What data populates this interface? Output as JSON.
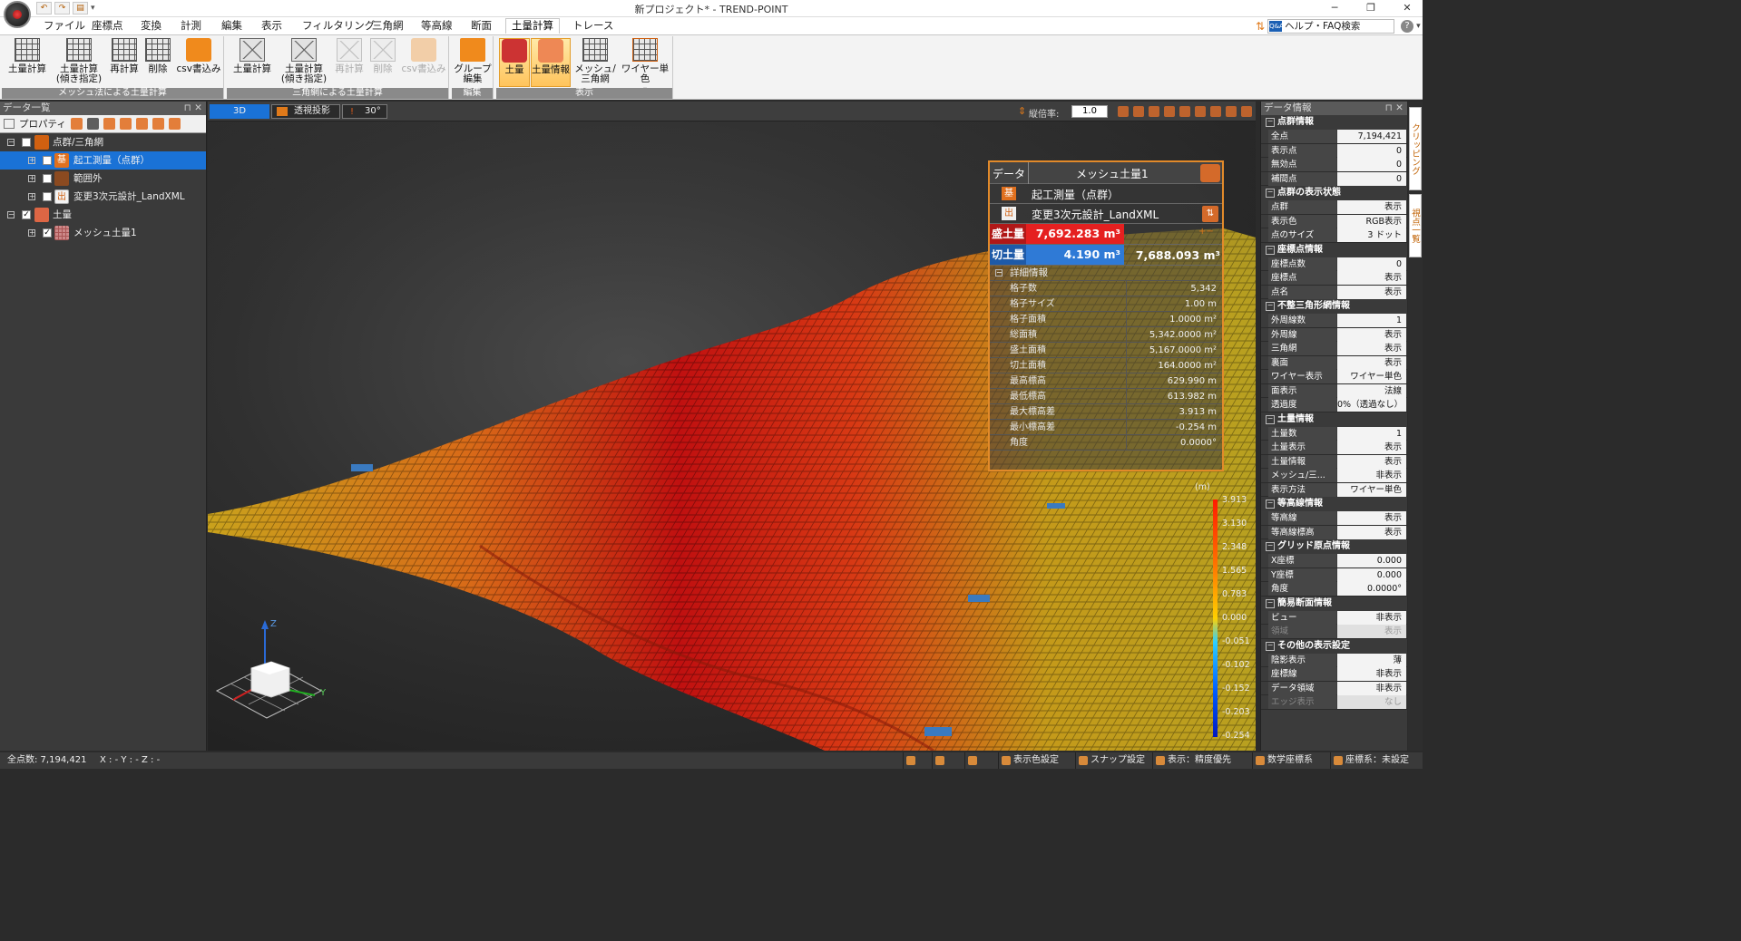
{
  "window": {
    "title": "新プロジェクト* - TREND-POINT"
  },
  "menus": [
    "ファイル",
    "座標点",
    "変換",
    "計測",
    "編集",
    "表示",
    "フィルタリング",
    "三角網",
    "等高線",
    "断面",
    "土量計算",
    "トレース"
  ],
  "help": {
    "label": "ヘルプ・FAQ検索",
    "placeholder": "ヘルプ・FAQ検索"
  },
  "ribbon": {
    "groups": [
      "メッシュ法による土量計算",
      "三角網による土量計算",
      "編集",
      "表示"
    ],
    "mesh": [
      "土量計算",
      "土量計算\n(傾き指定)",
      "再計算",
      "削除",
      "csv書込み"
    ],
    "tri": [
      "土量計算",
      "土量計算\n(傾き指定)",
      "再計算",
      "削除",
      "csv書込み"
    ],
    "edit": [
      "グループ\n編集"
    ],
    "display": [
      "土量",
      "土量情報",
      "メッシュ/\n三角網",
      "ワイヤー単色"
    ]
  },
  "left_panel": {
    "title": "データ一覧",
    "tool_label": "プロパティ",
    "tree": [
      {
        "label": "点群/三角網",
        "icon": ""
      },
      {
        "label": "起工測量（点群）",
        "icon": "基"
      },
      {
        "label": "範囲外",
        "icon": ""
      },
      {
        "label": "変更3次元設計_LandXML",
        "icon": "出"
      },
      {
        "label": "土量",
        "icon": ""
      },
      {
        "label": "メッシュ土量1",
        "icon": ""
      }
    ]
  },
  "viewport": {
    "mode_3d": "3D",
    "projection": "透視投影",
    "angle": "30°",
    "zoom_label": "縦倍率:",
    "zoom_value": "1.0",
    "axes": {
      "z": "Z",
      "y": "Y"
    }
  },
  "data_panel": {
    "header_key": "データ",
    "header_value": "メッシュ土量1",
    "base_icon": "基",
    "base_name": "起工測量（点群）",
    "design_icon": "出",
    "design_name": "変更3次元設計_LandXML",
    "fill_label": "盛土量",
    "fill_value": "7,692.283 m³",
    "cut_label": "切土量",
    "cut_value": "4.190 m³",
    "net_value": "7,688.093 m³",
    "detail_title": "詳細情報",
    "details": [
      {
        "k": "格子数",
        "v": "5,342"
      },
      {
        "k": "格子サイズ",
        "v": "1.00 m"
      },
      {
        "k": "格子面積",
        "v": "1.0000 m²"
      },
      {
        "k": "総面積",
        "v": "5,342.0000 m²"
      },
      {
        "k": "盛土面積",
        "v": "5,167.0000 m²"
      },
      {
        "k": "切土面積",
        "v": "164.0000 m²"
      },
      {
        "k": "最高標高",
        "v": "629.990 m"
      },
      {
        "k": "最低標高",
        "v": "613.982 m"
      },
      {
        "k": "最大標高差",
        "v": "3.913 m"
      },
      {
        "k": "最小標高差",
        "v": "-0.254 m"
      },
      {
        "k": "角度",
        "v": "0.0000°"
      }
    ]
  },
  "legend": {
    "unit": "(m)",
    "values": [
      "3.913",
      "3.130",
      "2.348",
      "1.565",
      "0.783",
      "0.000",
      "-0.051",
      "-0.102",
      "-0.152",
      "-0.203",
      "-0.254"
    ]
  },
  "right_panel": {
    "title": "データ情報",
    "sections": [
      {
        "title": "点群情報",
        "rows": [
          [
            "全点",
            "7,194,421"
          ],
          [
            "表示点",
            "0"
          ],
          [
            "無効点",
            "0"
          ],
          [
            "補間点",
            "0"
          ]
        ]
      },
      {
        "title": "点群の表示状態",
        "rows": [
          [
            "点群",
            "表示"
          ],
          [
            "表示色",
            "RGB表示"
          ],
          [
            "点のサイズ",
            "3 ドット"
          ]
        ]
      },
      {
        "title": "座標点情報",
        "rows": [
          [
            "座標点数",
            "0"
          ],
          [
            "座標点",
            "表示"
          ],
          [
            "点名",
            "表示"
          ]
        ]
      },
      {
        "title": "不整三角形網情報",
        "rows": [
          [
            "外周線数",
            "1"
          ],
          [
            "外周線",
            "表示"
          ],
          [
            "三角網",
            "表示"
          ],
          [
            "裏面",
            "表示"
          ],
          [
            "ワイヤー表示",
            "ワイヤー単色"
          ],
          [
            "面表示",
            "法線"
          ],
          [
            "透過度",
            "0%（透過なし）"
          ]
        ]
      },
      {
        "title": "土量情報",
        "rows": [
          [
            "土量数",
            "1"
          ],
          [
            "土量表示",
            "表示"
          ],
          [
            "土量情報",
            "表示"
          ],
          [
            "メッシュ/三...",
            "非表示"
          ],
          [
            "表示方法",
            "ワイヤー単色"
          ]
        ]
      },
      {
        "title": "等高線情報",
        "rows": [
          [
            "等高線",
            "表示"
          ],
          [
            "等高線標高",
            "表示"
          ]
        ]
      },
      {
        "title": "グリッド原点情報",
        "rows": [
          [
            "X座標",
            "0.000"
          ],
          [
            "Y座標",
            "0.000"
          ],
          [
            "角度",
            "0.0000°"
          ]
        ]
      },
      {
        "title": "簡易断面情報",
        "rows": [
          [
            "ビュー",
            "非表示"
          ],
          [
            "領域",
            "表示"
          ]
        ]
      },
      {
        "title": "その他の表示設定",
        "rows": [
          [
            "陰影表示",
            "薄"
          ],
          [
            "座標線",
            "非表示"
          ],
          [
            "データ領域",
            "非表示"
          ],
          [
            "エッジ表示",
            "なし"
          ]
        ]
      }
    ]
  },
  "side_tabs": [
    "クリッピング",
    "視点一覧"
  ],
  "status": {
    "total": "全点数: 7,194,421",
    "coords": "X : - Y : - Z : -",
    "items": [
      "表示色設定",
      "スナップ設定",
      "表示：精度優先",
      "数学座標系",
      "座標系：未設定"
    ]
  }
}
